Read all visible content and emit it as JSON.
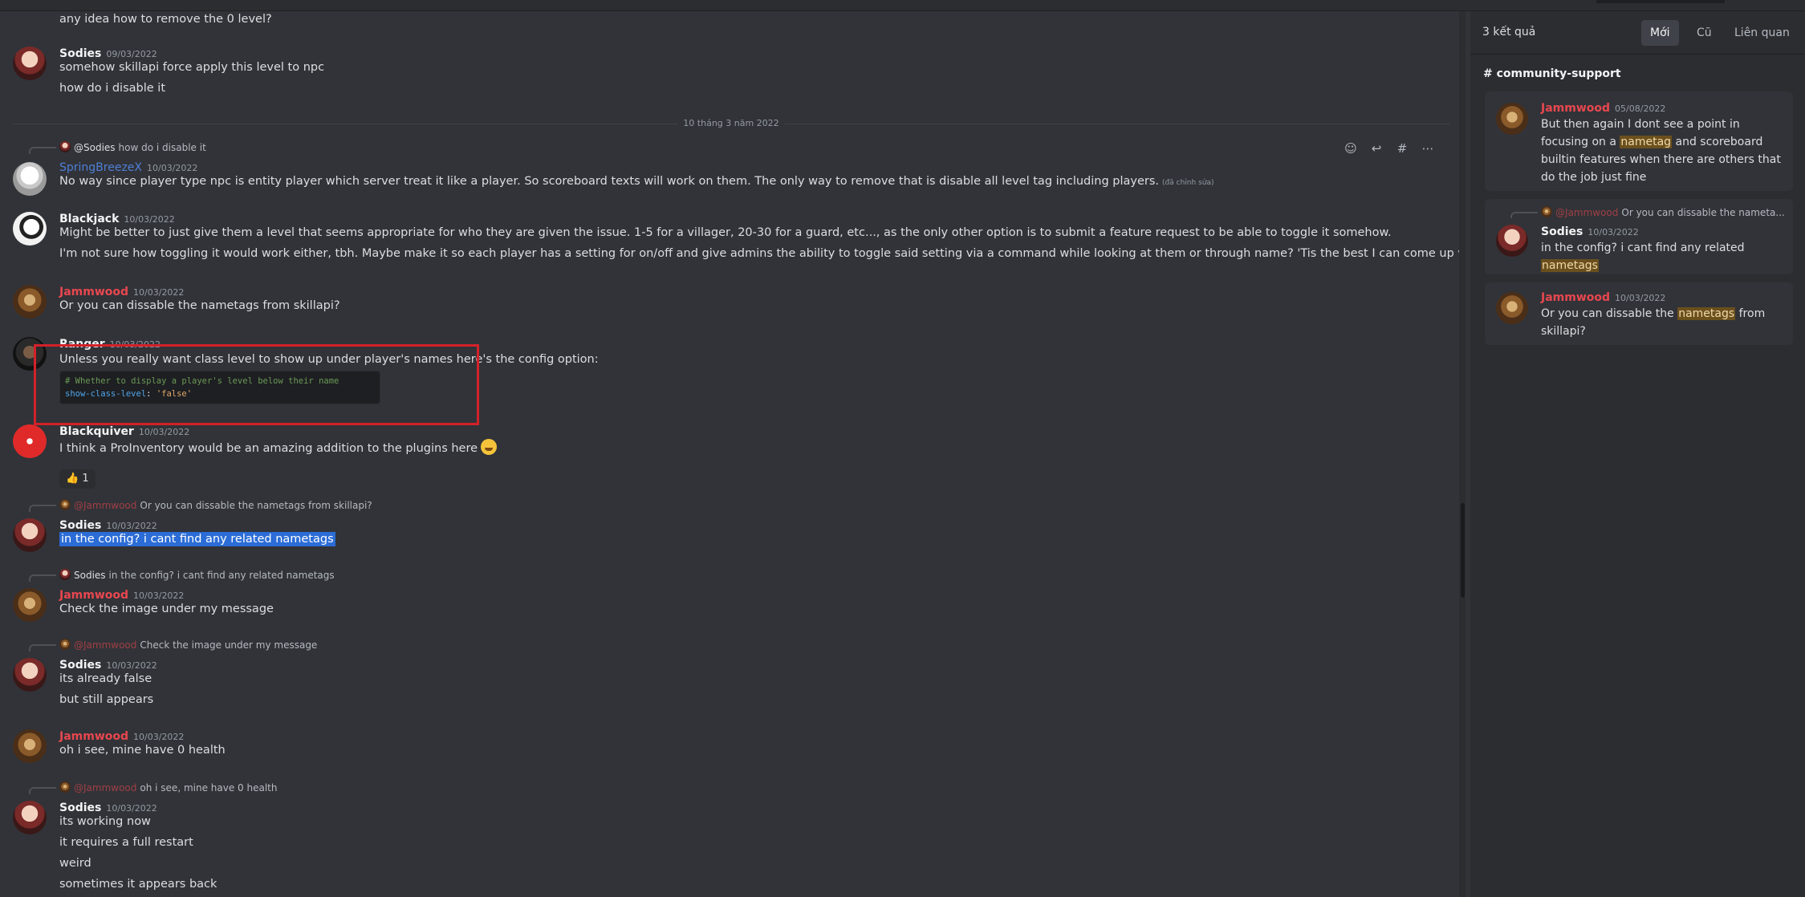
{
  "chat": {
    "m0": {
      "line": "any idea how to remove the 0 level?"
    },
    "m1": {
      "name": "Sodies",
      "ts": "09/03/2022",
      "lines": [
        "somehow skillapi force apply this level to npc",
        "how do i disable it"
      ]
    },
    "divider": "10 tháng 3 năm 2022",
    "m2": {
      "reply_name": "@Sodies",
      "reply_text": "how do i disable it",
      "name": "SpringBreezeX",
      "ts": "10/03/2022",
      "line": "No way since player type npc is entity player which server treat it like a player. So scoreboard texts will work on them. The only way to remove that is disable all level tag including players.",
      "edited": "(đã chỉnh sửa)"
    },
    "m3": {
      "name": "Blackjack",
      "ts": "10/03/2022",
      "lines": [
        "Might be better to just give them a level that seems appropriate for who they are given the issue. 1-5 for a villager, 20-30 for a guard, etc..., as the only other option is to submit a feature request to be able to toggle it somehow.",
        "I'm not sure how toggling it would work either, tbh. Maybe make it so each player has a setting for on/off and give admins the ability to toggle said setting via a command while looking at them or through name? 'Tis the best I can come up with."
      ]
    },
    "m4": {
      "name": "Jammwood",
      "ts": "10/03/2022",
      "line": "Or you can dissable the nametags from skillapi?"
    },
    "m5": {
      "name": "Ranger",
      "ts": "10/03/2022",
      "line": "Unless you really want class level to show up under player's names here's the config option:",
      "code_comment": "# Whether to display a player's level below their name",
      "code_key": "show-class-level",
      "code_colon": ": ",
      "code_value": "'false'"
    },
    "m6": {
      "name": "Blackquiver",
      "ts": "10/03/2022",
      "line": "I think a ProInventory would be an amazing addition to the plugins here",
      "reaction_emoji": "👍",
      "reaction_count": "1"
    },
    "m7": {
      "reply_name": "@Jammwood",
      "reply_text": "Or you can dissable the nametags from skillapi?",
      "name": "Sodies",
      "ts": "10/03/2022",
      "line": "in the config? i cant find any related nametags"
    },
    "m8": {
      "reply_name": "Sodies",
      "reply_text": "in the config? i cant find any related nametags",
      "name": "Jammwood",
      "ts": "10/03/2022",
      "line": "Check the image under my message"
    },
    "m9": {
      "reply_name": "@Jammwood",
      "reply_text": "Check the image under my message",
      "name": "Sodies",
      "ts": "10/03/2022",
      "lines": [
        "its already false",
        "but still appears"
      ]
    },
    "m10": {
      "name": "Jammwood",
      "ts": "10/03/2022",
      "line": "oh i see, mine have 0 health"
    },
    "m11": {
      "reply_name": "@Jammwood",
      "reply_text": "oh i see, mine have 0 health",
      "name": "Sodies",
      "ts": "10/03/2022",
      "lines": [
        "its working now",
        "it requires a full restart",
        "weird",
        "sometimes it appears back"
      ]
    }
  },
  "toolbar": {
    "icons": [
      "add-reaction-icon",
      "reply-icon",
      "create-thread-icon",
      "more-icon"
    ]
  },
  "search": {
    "result_count": "3 kết quả",
    "tabs": [
      "Mới",
      "Cũ",
      "Liên quan"
    ],
    "channel": "community-support",
    "results": [
      {
        "name": "Jammwood",
        "ts": "05/08/2022",
        "t1": "But then again I dont see a point in focusing on a ",
        "h1": "nametag",
        "t2": " and scoreboard builtin features when there are others that do the job just fine"
      },
      {
        "reply_name": "@Jammwood",
        "reply_text": "Or you can dissable the nameta...",
        "name": "Sodies",
        "ts": "10/03/2022",
        "t1": "in the config? i cant find any related ",
        "h1": "nametags"
      },
      {
        "name": "Jammwood",
        "ts": "10/03/2022",
        "t1": "Or you can dissable the ",
        "h1": "nametags",
        "t2": " from skillapi?"
      }
    ]
  },
  "colors": {
    "background": "#313338",
    "panel": "#2b2d31",
    "mention_red": "#e8474f",
    "selection": "#2b6cd6",
    "highlight_box": "#d3212a"
  }
}
